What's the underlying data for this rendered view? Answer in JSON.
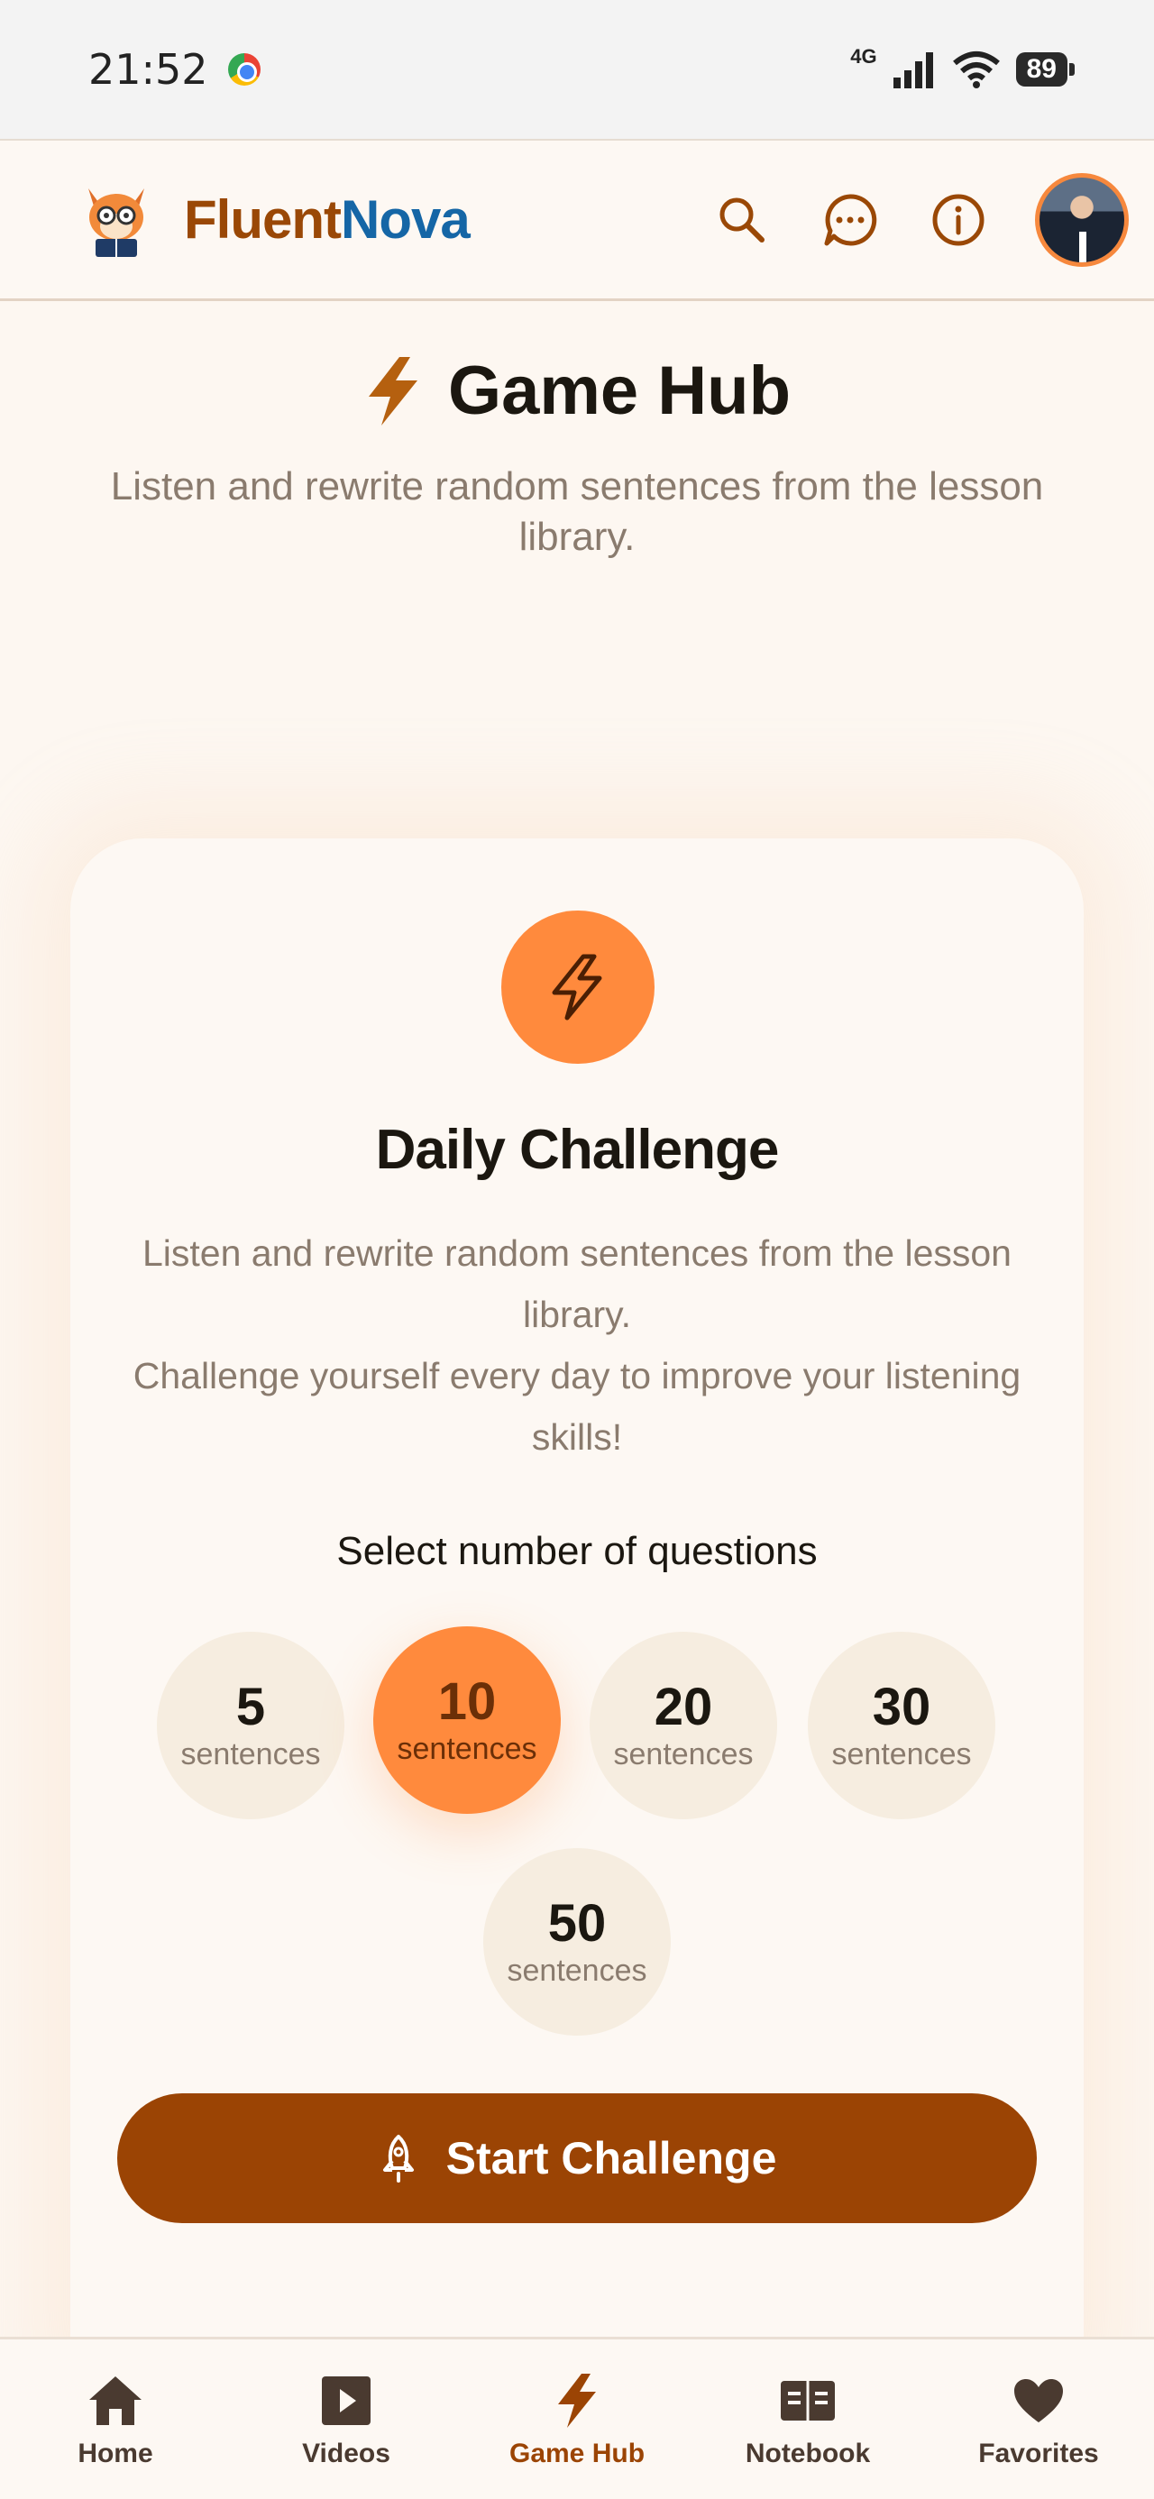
{
  "status_bar": {
    "time": "21:52",
    "network": "4G",
    "battery": "89"
  },
  "header": {
    "brand_part1": "Fluent",
    "brand_part2": "Nova",
    "icons": [
      "search-icon",
      "chat-icon",
      "info-icon"
    ]
  },
  "page": {
    "title": "Game Hub",
    "subtitle": "Listen and rewrite random sentences from the lesson library."
  },
  "card": {
    "title": "Daily Challenge",
    "description_line1": "Listen and rewrite random sentences from the lesson library.",
    "description_line2": "Challenge yourself every day to improve your listening skills!",
    "select_label": "Select number of questions",
    "options": [
      {
        "value": "5",
        "unit": "sentences"
      },
      {
        "value": "10",
        "unit": "sentences"
      },
      {
        "value": "20",
        "unit": "sentences"
      },
      {
        "value": "30",
        "unit": "sentences"
      },
      {
        "value": "50",
        "unit": "sentences"
      }
    ],
    "selected_option": "10",
    "start_button": "Start Challenge"
  },
  "bottom_nav": {
    "items": [
      {
        "label": "Home",
        "icon": "home-icon"
      },
      {
        "label": "Videos",
        "icon": "video-icon"
      },
      {
        "label": "Game Hub",
        "icon": "lightning-icon"
      },
      {
        "label": "Notebook",
        "icon": "notebook-icon"
      },
      {
        "label": "Favorites",
        "icon": "heart-icon"
      }
    ],
    "active": "Game Hub"
  },
  "colors": {
    "brand_orange": "#9a4806",
    "brand_blue": "#1566a6",
    "accent": "#ff8a3d",
    "button": "#9b4404",
    "background": "#fdf8f3"
  }
}
